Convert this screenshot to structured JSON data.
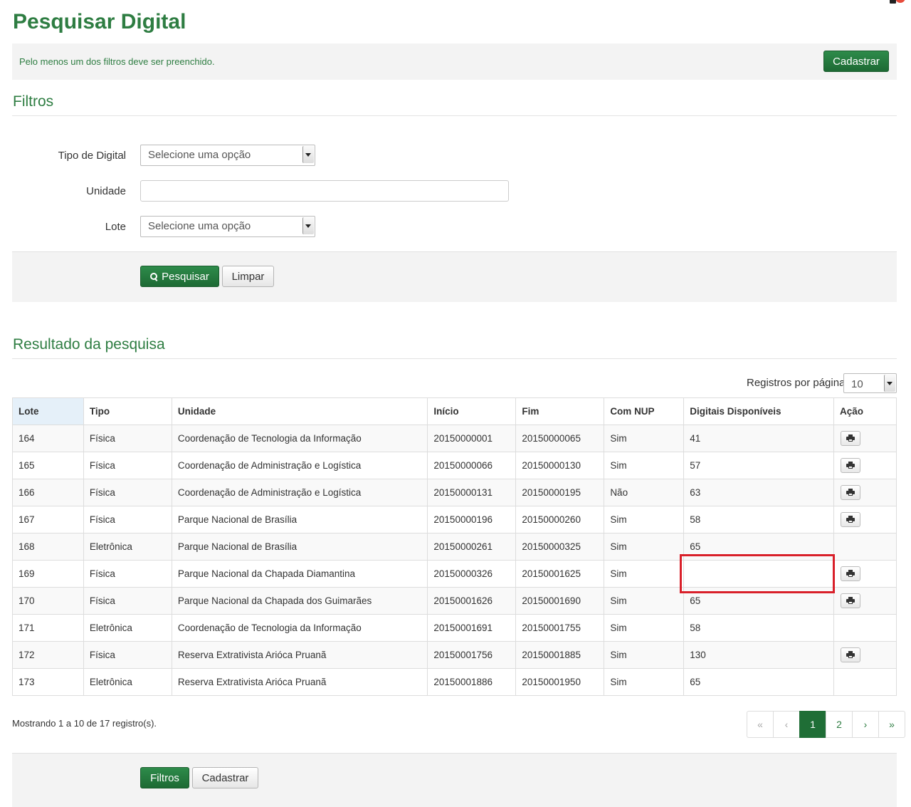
{
  "page": {
    "title": "Pesquisar Digital"
  },
  "info_bar": {
    "message": "Pelo menos um dos filtros deve ser preenchido.",
    "register_button": "Cadastrar"
  },
  "filters": {
    "title": "Filtros",
    "tipo_label": "Tipo de Digital",
    "tipo_value": "Selecione uma opção",
    "unidade_label": "Unidade",
    "unidade_value": "",
    "lote_label": "Lote",
    "lote_value": "Selecione uma opção",
    "search_button": "Pesquisar",
    "clear_button": "Limpar"
  },
  "results": {
    "title": "Resultado da pesquisa",
    "per_page_label": "Registros por página",
    "per_page_value": "10",
    "columns": [
      "Lote",
      "Tipo",
      "Unidade",
      "Início",
      "Fim",
      "Com NUP",
      "Digitais Disponíveis",
      "Ação"
    ],
    "rows": [
      {
        "lote": "164",
        "tipo": "Física",
        "unidade": "Coordenação de Tecnologia da Informação",
        "inicio": "20150000001",
        "fim": "20150000065",
        "nup": "Sim",
        "digitais": "41",
        "print": true
      },
      {
        "lote": "165",
        "tipo": "Física",
        "unidade": "Coordenação de Administração e Logística",
        "inicio": "20150000066",
        "fim": "20150000130",
        "nup": "Sim",
        "digitais": "57",
        "print": true
      },
      {
        "lote": "166",
        "tipo": "Física",
        "unidade": "Coordenação de Administração e Logística",
        "inicio": "20150000131",
        "fim": "20150000195",
        "nup": "Não",
        "digitais": "63",
        "print": true
      },
      {
        "lote": "167",
        "tipo": "Física",
        "unidade": "Parque Nacional de Brasília",
        "inicio": "20150000196",
        "fim": "20150000260",
        "nup": "Sim",
        "digitais": "58",
        "print": true
      },
      {
        "lote": "168",
        "tipo": "Eletrônica",
        "unidade": "Parque Nacional de Brasília",
        "inicio": "20150000261",
        "fim": "20150000325",
        "nup": "Sim",
        "digitais": "65",
        "print": false
      },
      {
        "lote": "169",
        "tipo": "Física",
        "unidade": "Parque Nacional da Chapada Diamantina",
        "inicio": "20150000326",
        "fim": "20150001625",
        "nup": "Sim",
        "digitais": "",
        "print": true
      },
      {
        "lote": "170",
        "tipo": "Física",
        "unidade": "Parque Nacional da Chapada dos Guimarães",
        "inicio": "20150001626",
        "fim": "20150001690",
        "nup": "Sim",
        "digitais": "65",
        "print": true
      },
      {
        "lote": "171",
        "tipo": "Eletrônica",
        "unidade": "Coordenação de Tecnologia da Informação",
        "inicio": "20150001691",
        "fim": "20150001755",
        "nup": "Sim",
        "digitais": "58",
        "print": false
      },
      {
        "lote": "172",
        "tipo": "Física",
        "unidade": "Reserva Extrativista Arióca Pruanã",
        "inicio": "20150001756",
        "fim": "20150001885",
        "nup": "Sim",
        "digitais": "130",
        "print": true
      },
      {
        "lote": "173",
        "tipo": "Eletrônica",
        "unidade": "Reserva Extrativista Arióca Pruanã",
        "inicio": "20150001886",
        "fim": "20150001950",
        "nup": "Sim",
        "digitais": "65",
        "print": false
      }
    ],
    "footer_text": "Mostrando 1 a 10 de 17 registro(s).",
    "pagination": [
      "«",
      "‹",
      "1",
      "2",
      "›",
      "»"
    ],
    "active_page": "1"
  },
  "bottom_bar": {
    "filters_button": "Filtros",
    "register_button": "Cadastrar"
  },
  "colors": {
    "brand_green": "#2e7d42",
    "highlight_red": "#d9202a"
  },
  "icons": {
    "action": "printer-icon",
    "search": "search-icon",
    "notification": "bell-icon"
  }
}
